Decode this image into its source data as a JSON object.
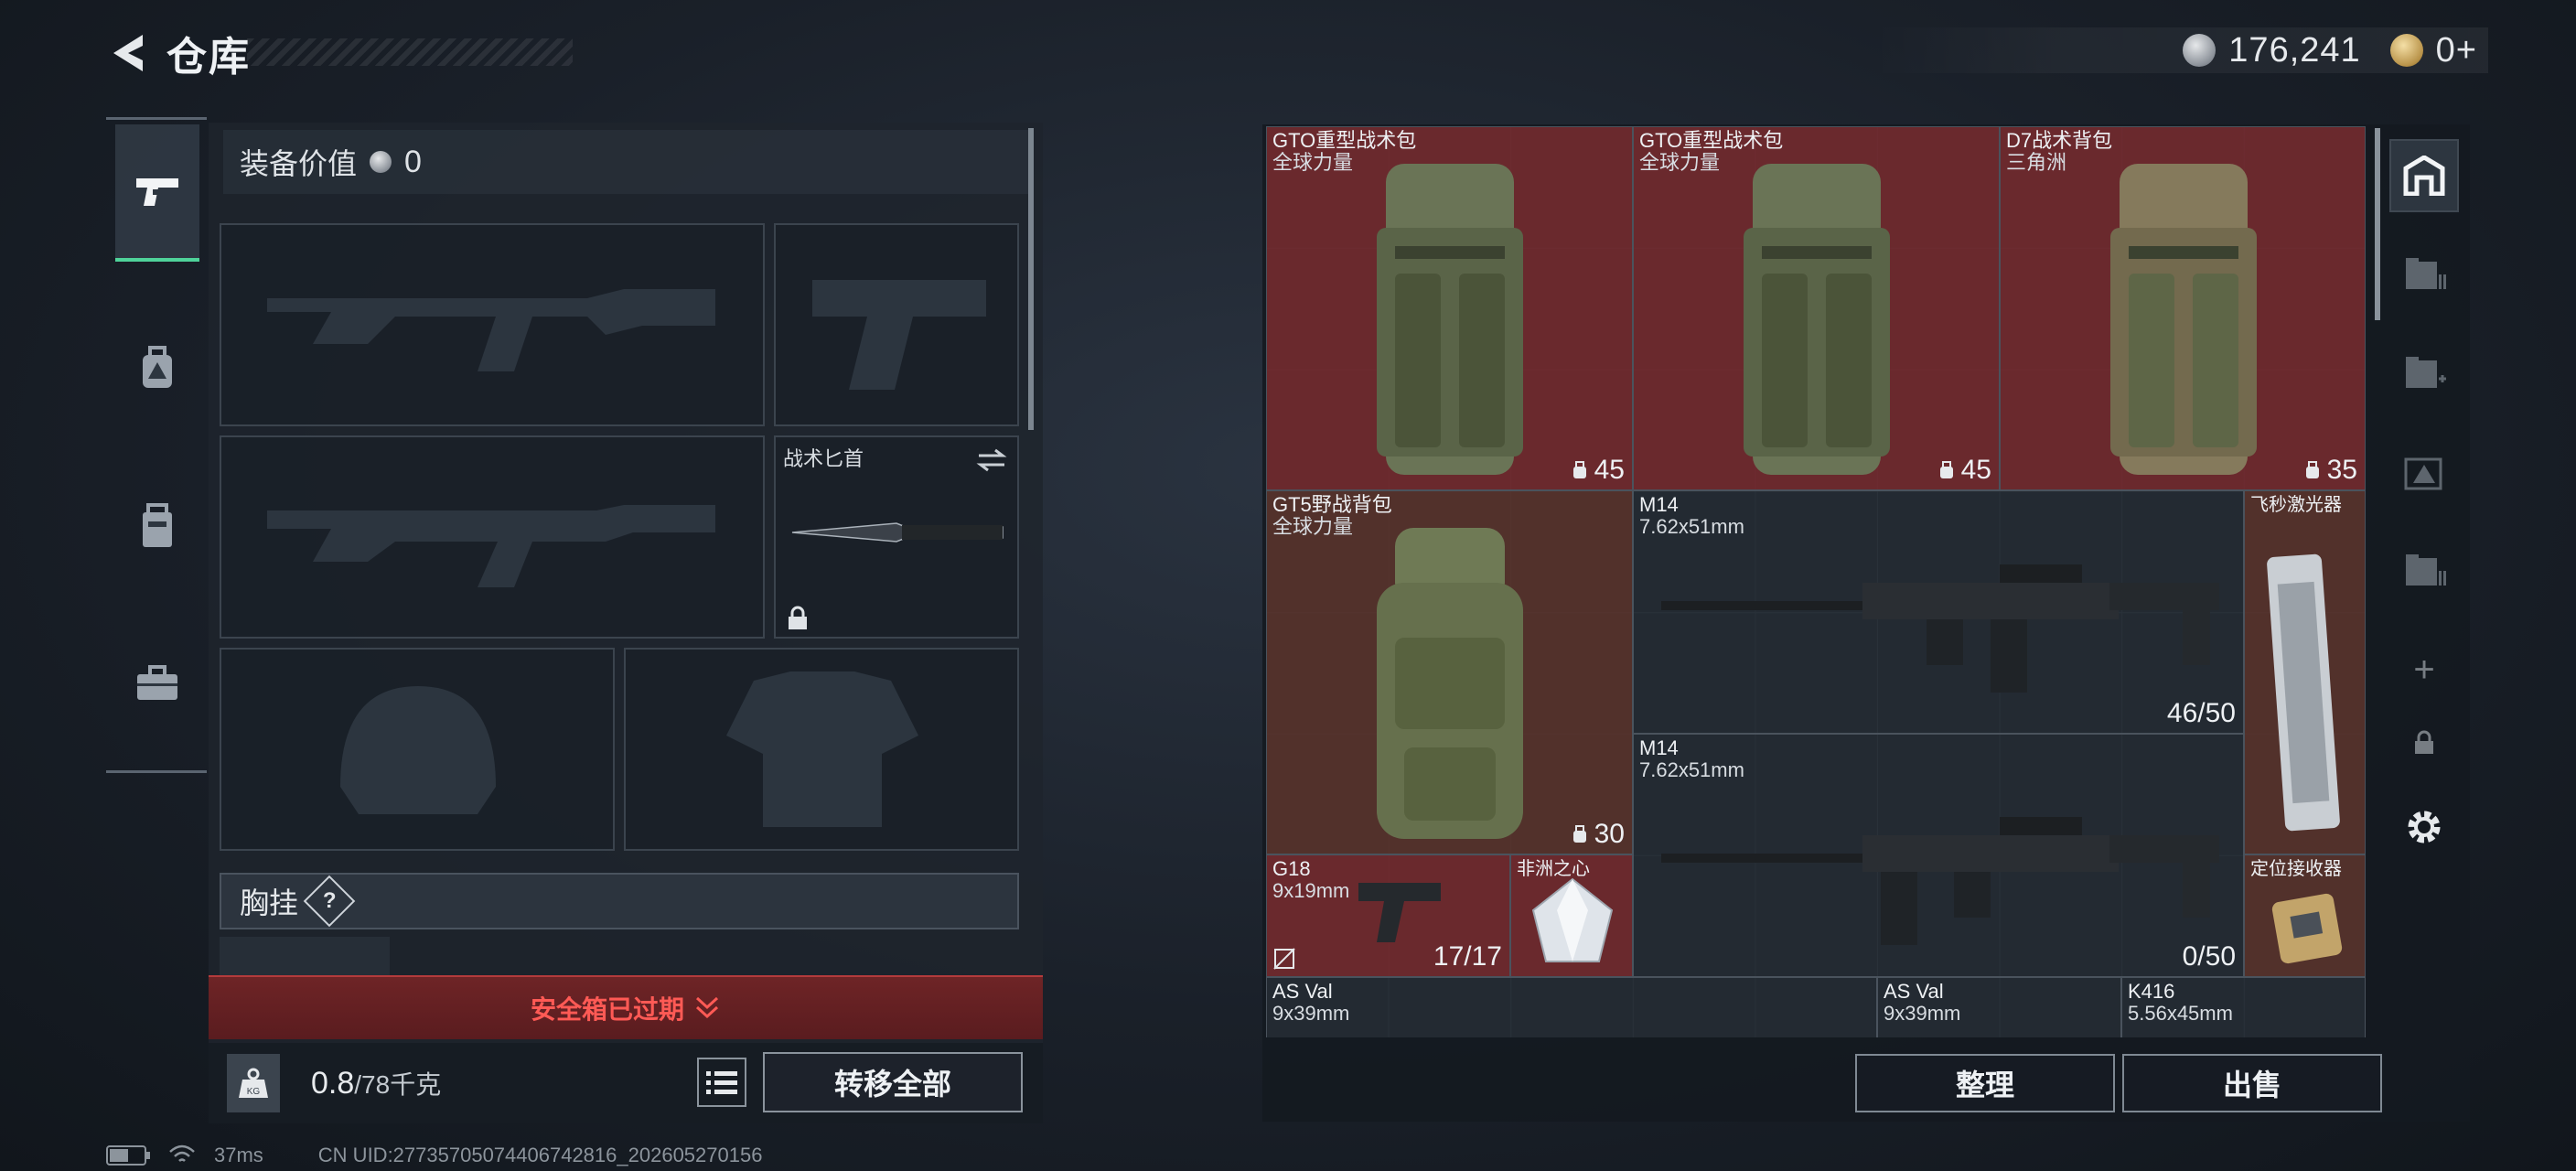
{
  "header": {
    "title": "仓库",
    "currency_silver": "176,241",
    "currency_gold": "0+"
  },
  "left_panel": {
    "equip_value_label": "装备价值",
    "equip_value": "0",
    "knife_slot_label": "战术匕首",
    "chest_rig_label": "胸挂",
    "chest_rig_help": "?",
    "safebox_status": "安全箱已过期",
    "weight_current": "0.8",
    "weight_max": "/78千克",
    "transfer_all_label": "转移全部"
  },
  "status_bar": {
    "ping": "37ms",
    "uid": "CN UID:27735705074406742816_202605270156"
  },
  "grid_items": [
    {
      "name": "GTO重型战术包",
      "sub": "全球力量",
      "count": "45"
    },
    {
      "name": "GTO重型战术包",
      "sub": "全球力量",
      "count": "45"
    },
    {
      "name": "D7战术背包",
      "sub": "三角洲",
      "count": "35"
    },
    {
      "name": "GT5野战背包",
      "sub": "全球力量",
      "count": "30"
    },
    {
      "name": "M14",
      "sub": "7.62x51mm",
      "count": "46/50"
    },
    {
      "name": "飞秒激光器",
      "sub": "",
      "count": ""
    },
    {
      "name": "M14",
      "sub": "7.62x51mm",
      "count": "0/50"
    },
    {
      "name": "G18",
      "sub": "9x19mm",
      "count": "17/17"
    },
    {
      "name": "非洲之心",
      "sub": "",
      "count": ""
    },
    {
      "name": "定位接收器",
      "sub": "",
      "count": ""
    },
    {
      "name": "AS Val",
      "sub": "9x39mm",
      "count": ""
    },
    {
      "name": "AS Val",
      "sub": "9x39mm",
      "count": ""
    },
    {
      "name": "K416",
      "sub": "5.56x45mm",
      "count": ""
    }
  ],
  "actions": {
    "sort_label": "整理",
    "sell_label": "出售"
  },
  "right_rail": {
    "add_label": "+"
  },
  "colors": {
    "accent_green": "#4fd39a",
    "warning_red": "#ff5a55",
    "item_red_bg": "#782a2e"
  }
}
